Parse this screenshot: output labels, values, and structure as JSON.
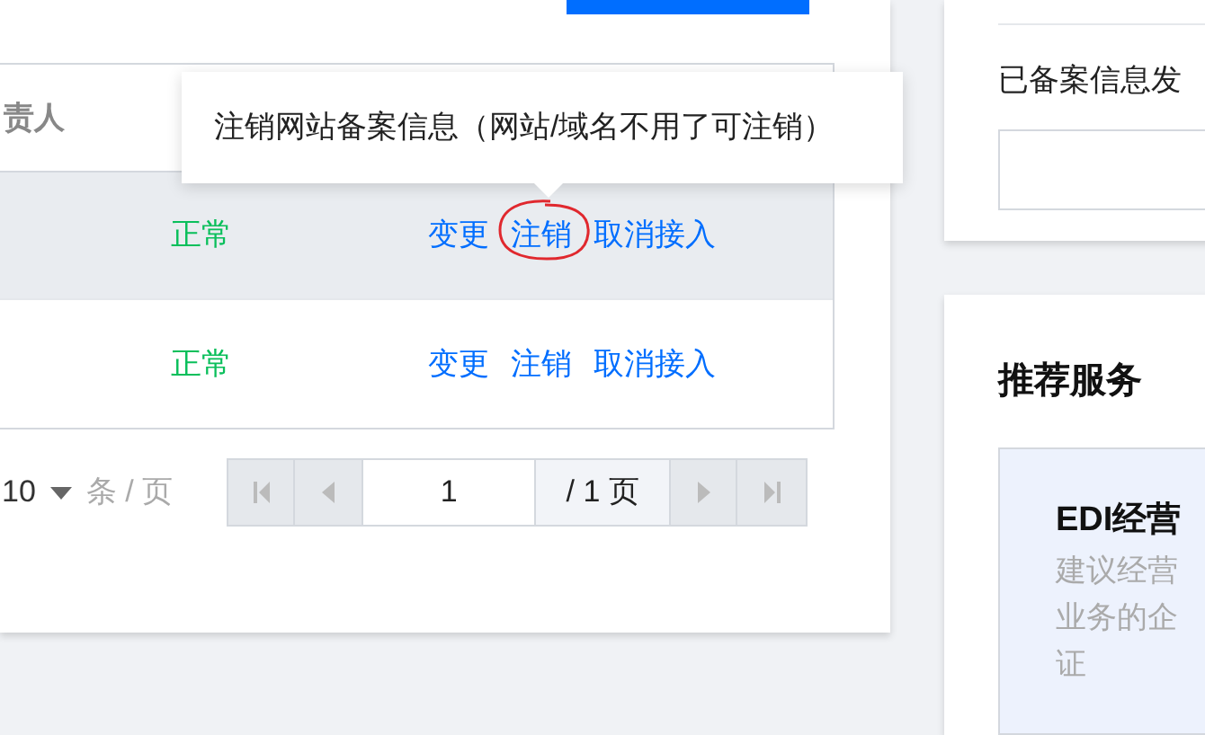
{
  "table": {
    "columns": [
      "责人"
    ],
    "rows": [
      {
        "status": "正常",
        "selected": true,
        "actions": [
          "变更",
          "注销",
          "取消接入"
        ]
      },
      {
        "status": "正常",
        "selected": false,
        "actions": [
          "变更",
          "注销",
          "取消接入"
        ]
      }
    ]
  },
  "tooltip": {
    "text": "注销网站备案信息（网站/域名不用了可注销）"
  },
  "pagination": {
    "page_size": "10",
    "unit": "条 / 页",
    "page": "1",
    "total": "/ 1 页"
  },
  "notice_card": {
    "text": "已备案信息发"
  },
  "recommend": {
    "title": "推荐服务",
    "card": {
      "title": "EDI经营",
      "lines": [
        "建议经营",
        "业务的企",
        "证"
      ]
    }
  }
}
